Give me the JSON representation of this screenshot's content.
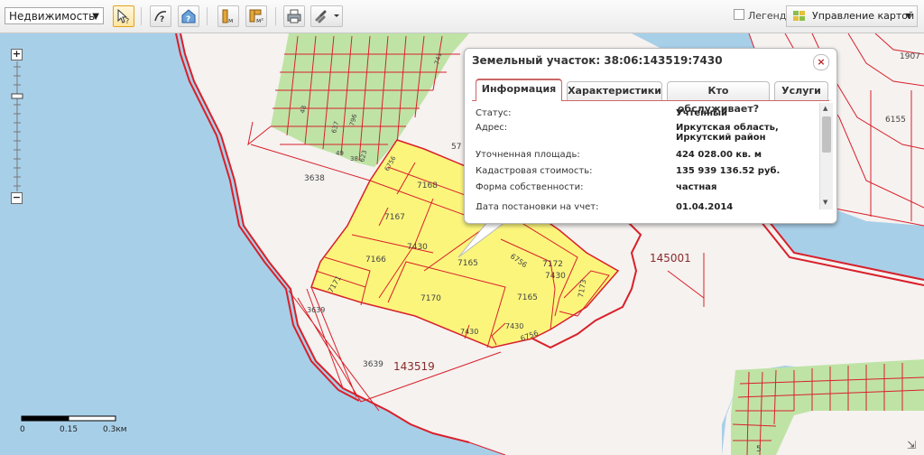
{
  "toolbar": {
    "layer_select": "Недвижимость",
    "legend_label": "Легенда",
    "map_control_label": "Управление картой"
  },
  "popup": {
    "title": "Земельный участок: 38:06:143519:7430",
    "tabs": [
      "Информация",
      "Характеристики",
      "Кто обслуживает?",
      "Услуги"
    ],
    "rows": [
      {
        "key": "Статус:",
        "value": "Учтенный"
      },
      {
        "key": "Адрес:",
        "value": "Иркутская область, Иркутский район"
      },
      {
        "key": "Уточненная площадь:",
        "value": "424 028.00 кв. м"
      },
      {
        "key": "Кадастровая стоимость:",
        "value": "135 939 136.52 руб."
      },
      {
        "key": "Форма собственности:",
        "value": "частная"
      },
      {
        "key": "Дата постановки на учет:",
        "value": "01.04.2014"
      }
    ]
  },
  "map_labels": {
    "l7168": "7168",
    "l7167": "7167",
    "l7166": "7166",
    "l7171": "7171",
    "l7170": "7170",
    "l7165a": "7165",
    "l7165b": "7165",
    "l7430a": "7430",
    "l7430b": "7430",
    "l7430c": "7430",
    "l7430d": "7430",
    "l7172": "7172",
    "l7173": "7173",
    "l6756a": "6756",
    "l6756b": "6756",
    "l6756c": "6756",
    "l3638": "3638",
    "l3639a": "3639",
    "l3639b": "3639",
    "l143519": "143519",
    "l145001": "145001",
    "l1907": "1907",
    "l6155": "6155",
    "l5": "5",
    "l48": "48",
    "l637": "637",
    "l796": "796",
    "l49": "49",
    "l38": "38",
    "l623": "623",
    "l741": "741",
    "l57": "57"
  },
  "scale": {
    "ticks": [
      "0",
      "0.15",
      "0.3км"
    ]
  },
  "colors": {
    "parcel_fill": "#fbf57c",
    "boundary": "#d9202a",
    "water": "#a8cfe8",
    "green": "#bfe3a5",
    "land": "#f5f2f0"
  }
}
